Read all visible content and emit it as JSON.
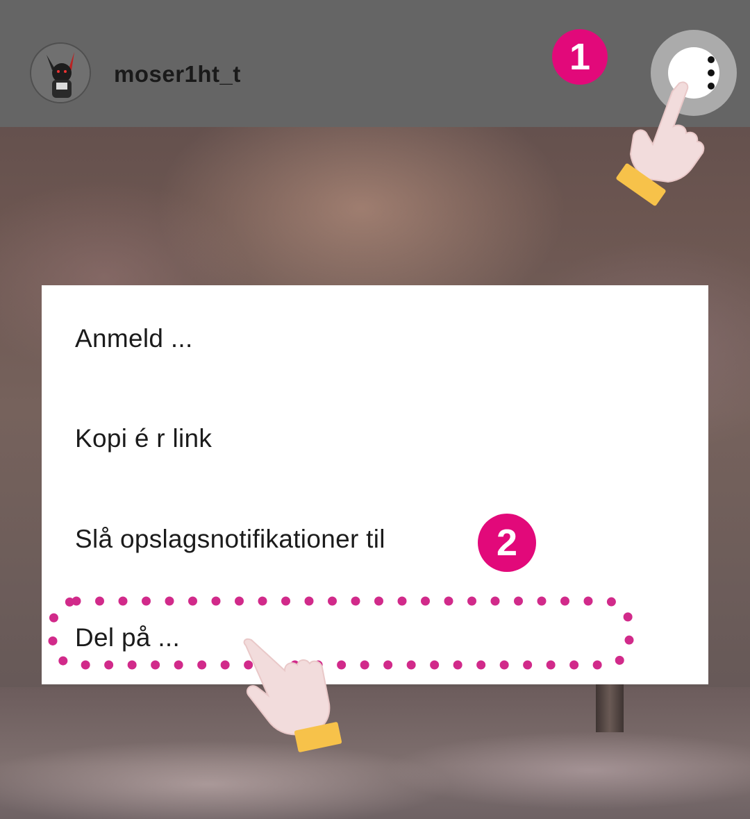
{
  "header": {
    "username": "moser1ht_t",
    "more_icon": "vertical-ellipsis-icon"
  },
  "badges": {
    "step1": "1",
    "step2": "2"
  },
  "menu": {
    "items": [
      {
        "label": "Anmeld ..."
      },
      {
        "label": "Kopi é r link"
      },
      {
        "label": "Slå opslagsnotifikationer til"
      },
      {
        "label": "Del på ..."
      }
    ]
  },
  "colors": {
    "accent": "#e2097a",
    "header_bg": "#656565",
    "menu_bg": "#ffffff",
    "hand_skin": "#f2dcdc",
    "hand_cuff": "#f7c24a"
  }
}
